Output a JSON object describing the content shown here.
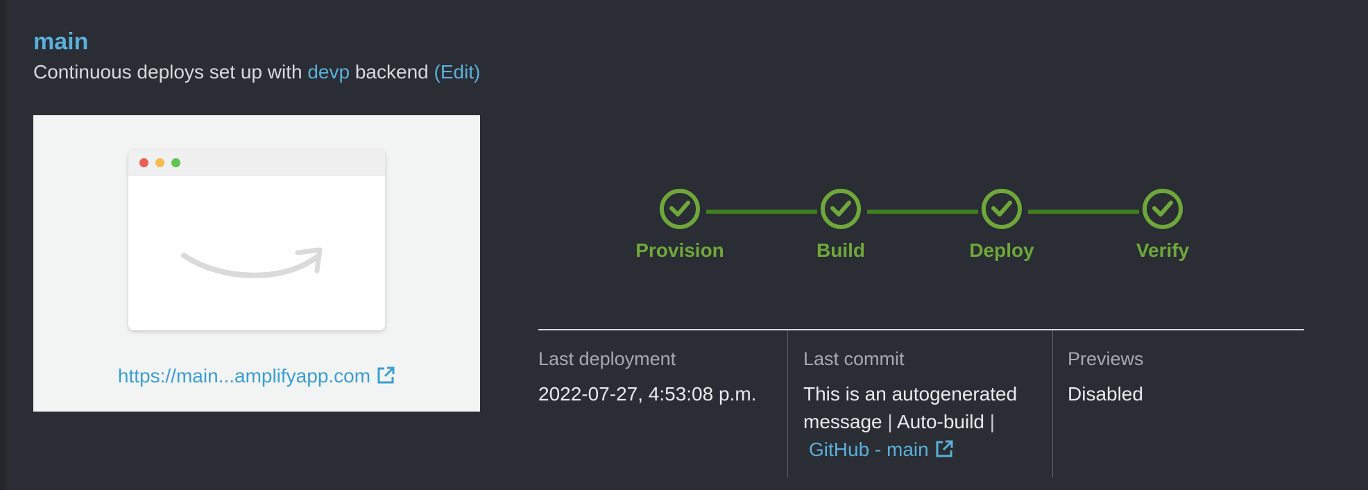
{
  "branch": {
    "name": "main",
    "subtitle_prefix": "Continuous deploys set up with",
    "backend_name": "devp",
    "subtitle_suffix": "backend",
    "edit_label": "(Edit)"
  },
  "preview": {
    "url": "https://main...amplifyapp.com",
    "icon": "external-link-icon"
  },
  "pipeline": {
    "stages": [
      {
        "label": "Provision",
        "status": "succeeded",
        "icon": "check-circle-icon"
      },
      {
        "label": "Build",
        "status": "succeeded",
        "icon": "check-circle-icon"
      },
      {
        "label": "Deploy",
        "status": "succeeded",
        "icon": "check-circle-icon"
      },
      {
        "label": "Verify",
        "status": "succeeded",
        "icon": "check-circle-icon"
      }
    ],
    "color": "#6ea83a"
  },
  "details": {
    "last_deployment_label": "Last deployment",
    "last_deployment_value": "2022-07-27, 4:53:08 p.m.",
    "last_commit_label": "Last commit",
    "last_commit_line1": "This is an autogenerated",
    "last_commit_line2_a": "message",
    "last_commit_line2_b": "Auto-build",
    "last_commit_link": "GitHub - main",
    "pipe": "|",
    "previews_label": "Previews",
    "previews_value": "Disabled"
  },
  "colors": {
    "background": "#2a2d33",
    "link": "#5ab0dc",
    "success": "#6ea83a"
  }
}
